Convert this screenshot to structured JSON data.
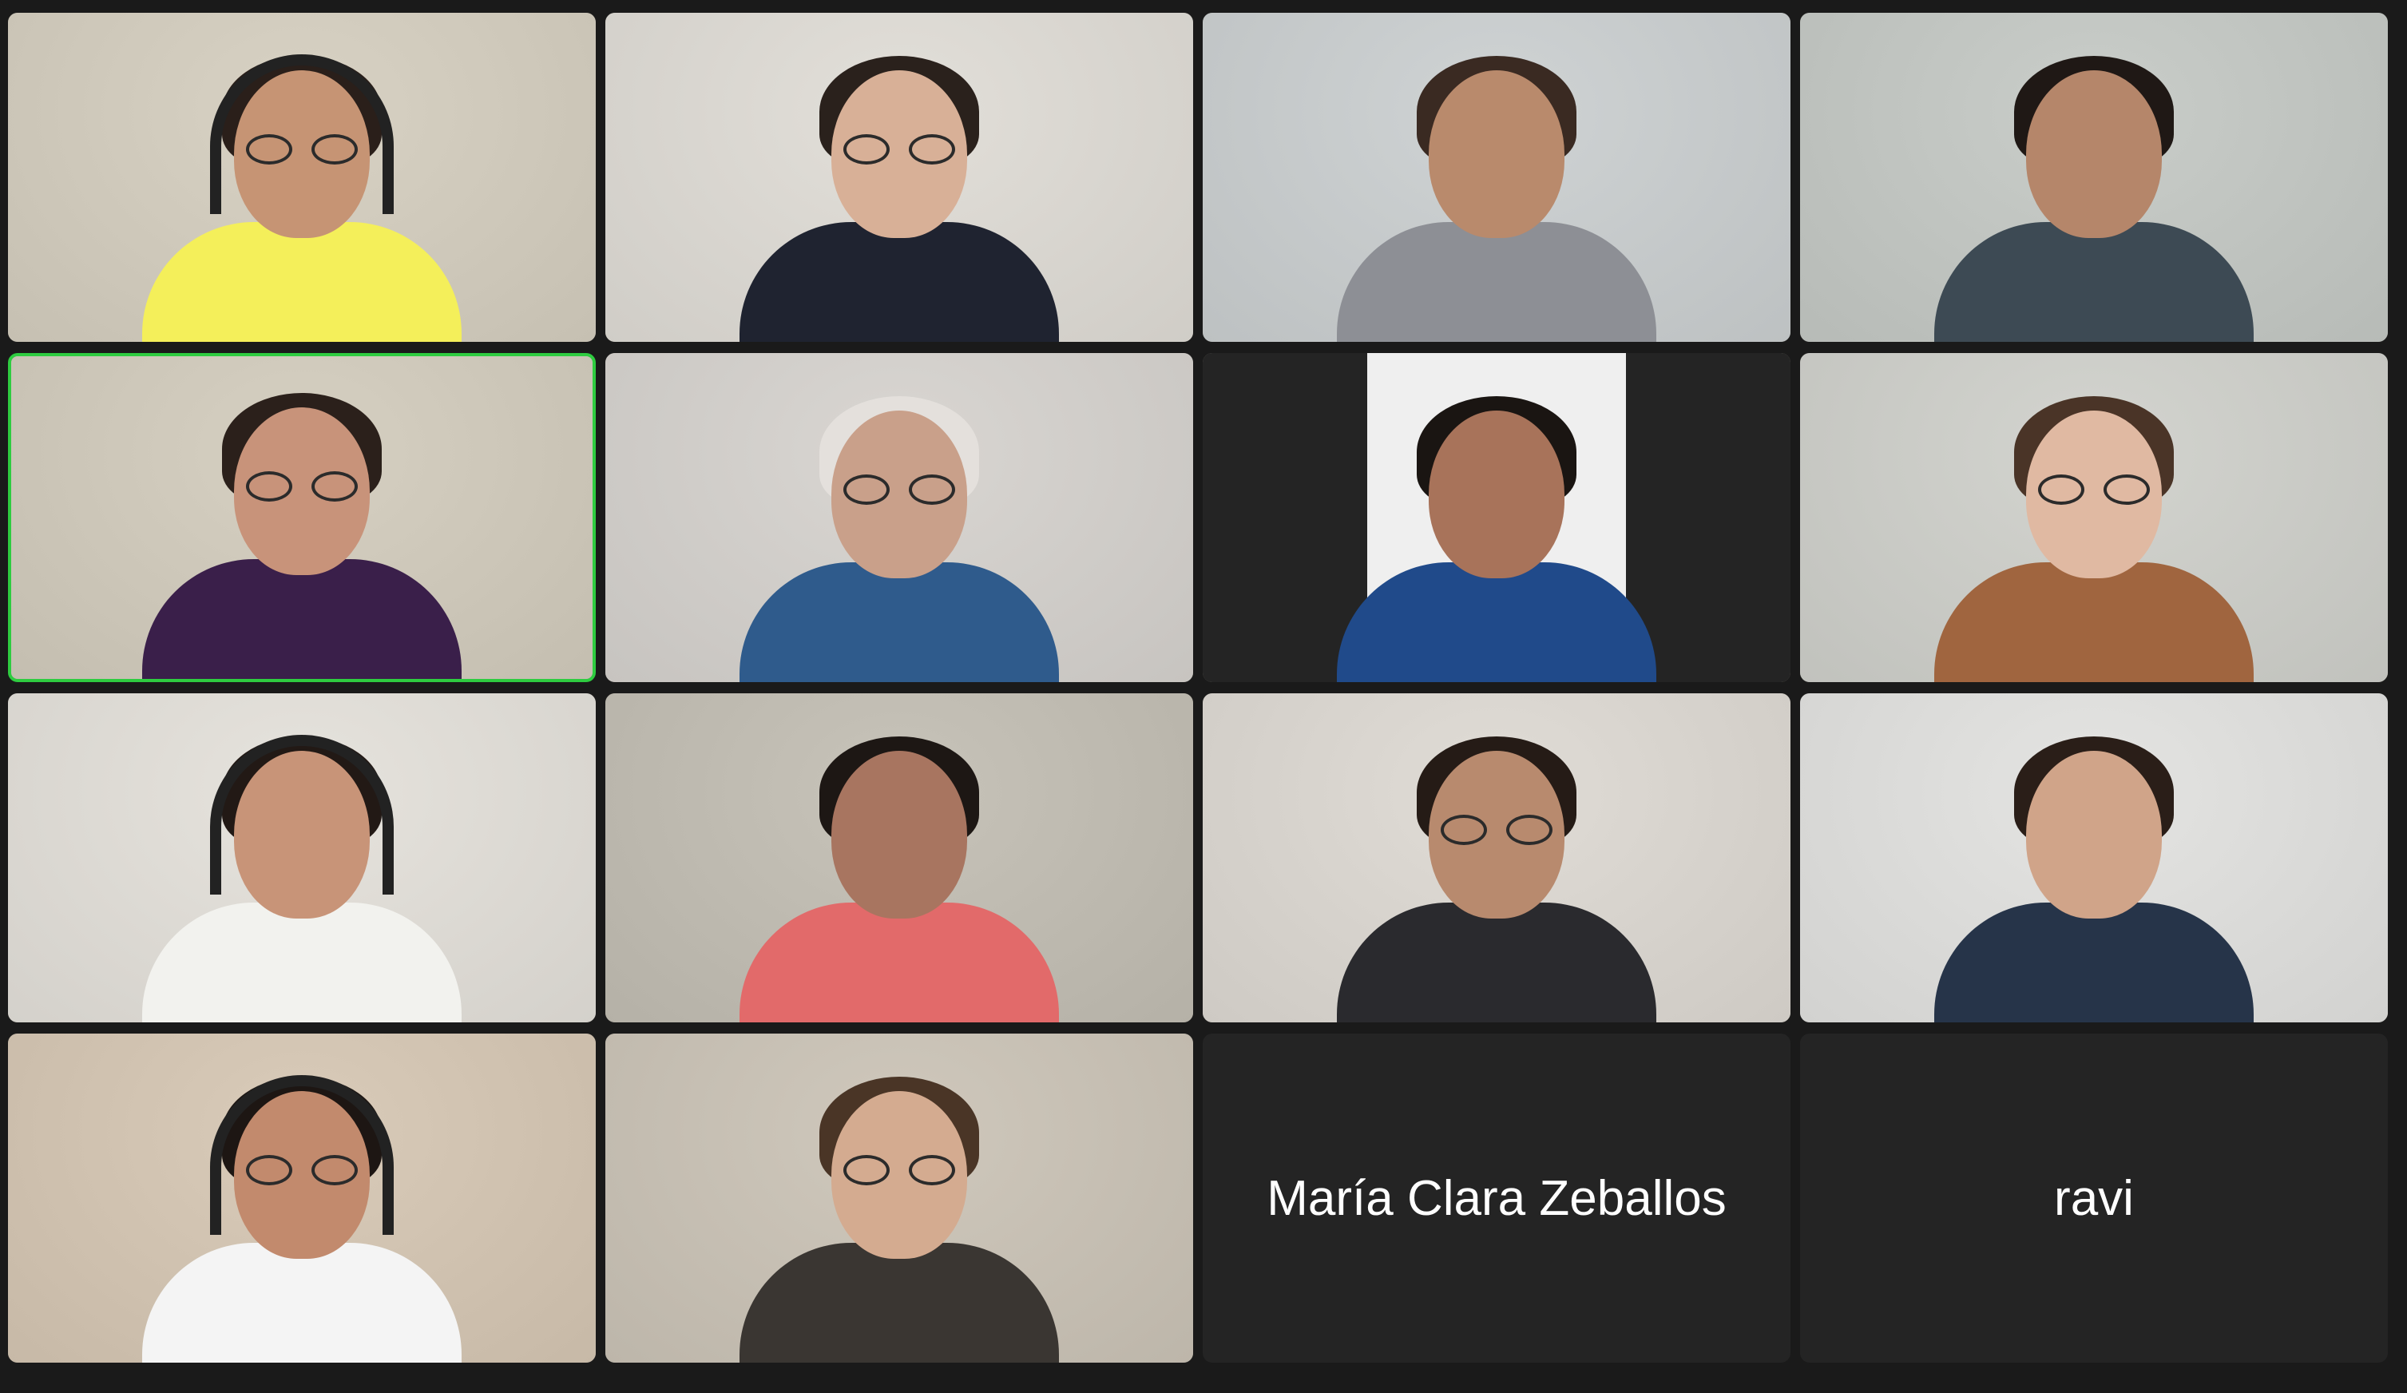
{
  "gallery": {
    "background_color": "#1a1a1a",
    "active_speaker_color": "#2ecc40",
    "tiles": [
      {
        "type": "video",
        "icon": "participant-video-1",
        "headphones": true,
        "glasses": true,
        "shirt": "#f4ef5a",
        "skin": "#c69474",
        "hair": "#2a1f1a",
        "bg": "#d8d2c4"
      },
      {
        "type": "video",
        "icon": "participant-video-2",
        "headphones": false,
        "glasses": true,
        "shirt": "#1f2330",
        "skin": "#d8b097",
        "hair": "#2a211c",
        "bg": "#e2dfd9"
      },
      {
        "type": "video",
        "icon": "participant-video-3",
        "headphones": false,
        "glasses": false,
        "shirt": "#8d8f95",
        "skin": "#b98a6c",
        "hair": "#3a2a22",
        "bg": "#cfd3d4"
      },
      {
        "type": "video",
        "icon": "participant-video-4",
        "headphones": false,
        "glasses": false,
        "shirt": "#3d4a54",
        "skin": "#b5866a",
        "hair": "#1f1815",
        "bg": "#c9cdc9"
      },
      {
        "type": "video",
        "icon": "participant-video-5",
        "headphones": false,
        "glasses": true,
        "shirt": "#3a1f4a",
        "skin": "#c8937a",
        "hair": "#2b201b",
        "bg": "#d6d0c2",
        "active_speaker": true
      },
      {
        "type": "video",
        "icon": "participant-video-6",
        "headphones": false,
        "glasses": true,
        "shirt": "#2f5b8c",
        "skin": "#c9a08a",
        "hair": "#e4e0dc",
        "bg": "#d9d6d2"
      },
      {
        "type": "video",
        "icon": "participant-video-7",
        "headphones": false,
        "glasses": false,
        "shirt": "#204a8a",
        "skin": "#a8735a",
        "hair": "#1a1512",
        "bg": "#efefef",
        "letterbox": true
      },
      {
        "type": "video",
        "icon": "participant-video-8",
        "headphones": false,
        "glasses": true,
        "shirt": "#a0653f",
        "skin": "#e0b9a2",
        "hair": "#4a3427",
        "bg": "#d3d4cf"
      },
      {
        "type": "video",
        "icon": "participant-video-9",
        "headphones": true,
        "glasses": false,
        "shirt": "#f2f2ee",
        "skin": "#c89478",
        "hair": "#221915",
        "bg": "#e6e3dd"
      },
      {
        "type": "video",
        "icon": "participant-video-10",
        "headphones": false,
        "glasses": false,
        "shirt": "#e26a6a",
        "skin": "#a87560",
        "hair": "#1d1714",
        "bg": "#c7c3b9"
      },
      {
        "type": "video",
        "icon": "participant-video-11",
        "headphones": false,
        "glasses": true,
        "shirt": "#2a2a2e",
        "skin": "#b88a6e",
        "hair": "#251b16",
        "bg": "#e0dcd6"
      },
      {
        "type": "video",
        "icon": "participant-video-12",
        "headphones": false,
        "glasses": false,
        "shirt": "#263449",
        "skin": "#d0a489",
        "hair": "#2a1e18",
        "bg": "#e4e4e2"
      },
      {
        "type": "video",
        "icon": "participant-video-13",
        "headphones": true,
        "glasses": true,
        "shirt": "#f4f4f4",
        "skin": "#c28a6d",
        "hair": "#1d1613",
        "bg": "#d9cbb9"
      },
      {
        "type": "video",
        "icon": "participant-video-14",
        "headphones": false,
        "glasses": true,
        "shirt": "#3a3632",
        "skin": "#d4ab90",
        "hair": "#4a3526",
        "bg": "#cfc8bc"
      },
      {
        "type": "name",
        "name": "María Clara Zeballos"
      },
      {
        "type": "name",
        "name": "ravi"
      }
    ]
  }
}
